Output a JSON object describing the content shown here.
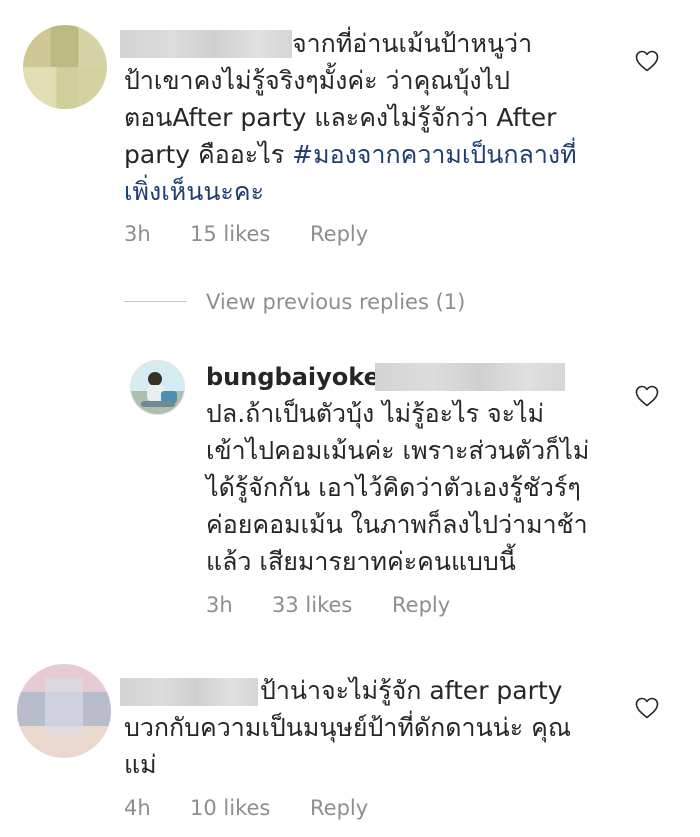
{
  "comments": [
    {
      "lines": [
        "จากที่อ่านเม้นป้าหนูว่า",
        "ป้าเขาคงไม่รู้จริงๆมั้งค่ะ ว่าคุณบุ้งไป",
        "ตอนAfter party  และคงไม่รู้จักว่า After",
        "party คืออะไร ",
        "เพิ่งเห็นนะคะ"
      ],
      "hashtag": "#มองจากความเป็นกลางที่",
      "time": "3h",
      "likes": "15 likes",
      "reply": "Reply"
    },
    {
      "username": "bungbaiyoke",
      "lines": [
        "ปล.ถ้าเป็นตัวบุ้ง ไม่รู้อะไร จะไม่",
        "เข้าไปคอมเม้นค่ะ เพราะส่วนตัวก็ไม่",
        "ได้รู้จักกัน เอาไว้คิดว่าตัวเองรู้ชัวร์ๆ",
        "ค่อยคอมเม้น ในภาพก็ลงไปว่ามาช้า",
        "แล้ว เสียมารยาทค่ะคนแบบนี้"
      ],
      "time": "3h",
      "likes": "33 likes",
      "reply": "Reply"
    },
    {
      "lines": [
        "ป้าน่าจะไม่รู้จัก after party",
        "บวกกับความเป็นมนุษย์ป้าที่ดักดานน่ะ คุณ",
        "แม่"
      ],
      "time": "4h",
      "likes": "10 likes",
      "reply": "Reply"
    }
  ],
  "view_previous": "View previous replies (1)",
  "icons": {
    "heart": "heart-outline-icon"
  },
  "colors": {
    "text": "#262626",
    "meta": "#8e8e8e",
    "hashtag": "#1e3e72"
  }
}
